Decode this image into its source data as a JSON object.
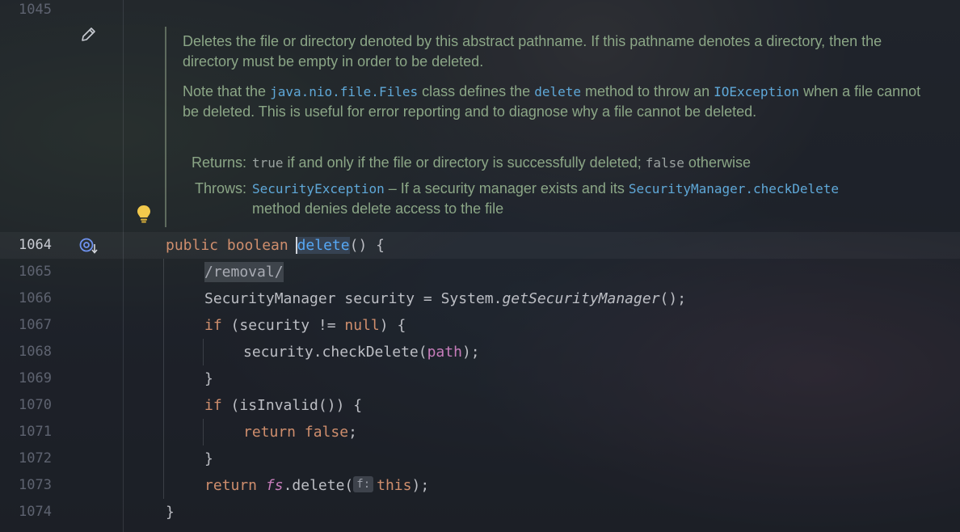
{
  "editor": {
    "language": "java",
    "doc": {
      "p1": "Deletes the file or directory denoted by this abstract pathname. If this pathname denotes a directory, then the directory must be empty in order to be deleted.",
      "p2_a": "Note that the ",
      "p2_code1": "java.nio.file.Files",
      "p2_b": " class defines the ",
      "p2_code2": "delete",
      "p2_c": " method to throw an ",
      "p2_code3": "IOException",
      "p2_d": " when a file cannot be deleted. This is useful for error reporting and to diagnose why a file cannot be deleted.",
      "returns_label": "Returns:",
      "returns_code1": "true",
      "returns_text": " if and only if the file or directory is successfully deleted; ",
      "returns_code2": "false",
      "returns_text2": " otherwise",
      "throws_label": "Throws:",
      "throws_code1": "SecurityException",
      "throws_text": " – If a security manager exists and its ",
      "throws_code2": "SecurityManager.checkDelete",
      "throws_text2": "method denies delete access to the file"
    },
    "line_numbers": [
      "1045",
      "1064",
      "1065",
      "1066",
      "1067",
      "1068",
      "1069",
      "1070",
      "1071",
      "1072",
      "1073",
      "1074"
    ],
    "code": {
      "l1064_public": "public",
      "l1064_boolean": "boolean",
      "l1064_name": "delete",
      "l1064_rest": "() {",
      "l1065": "/removal/",
      "l1066_a": "SecurityManager security = System.",
      "l1066_b": "getSecurityManager",
      "l1066_c": "();",
      "l1067_if": "if",
      "l1067_a": " (security != ",
      "l1067_null": "null",
      "l1067_b": ") {",
      "l1068_a": "security.checkDelete(",
      "l1068_path": "path",
      "l1068_b": ");",
      "l1069": "}",
      "l1070_if": "if",
      "l1070_a": " (isInvalid()) {",
      "l1071_return": "return",
      "l1071_false": "false",
      "l1071_b": ";",
      "l1072": "}",
      "l1073_return": "return",
      "l1073_fs": "fs",
      "l1073_a": ".delete(",
      "l1073_hint": "f:",
      "l1073_this": "this",
      "l1073_b": ");",
      "l1074": "}"
    },
    "icons": [
      "edit-pencil-icon",
      "lightbulb-icon",
      "override-method-icon"
    ],
    "colors": {
      "keyword": "#cf8e6d",
      "method": "#56a8f5",
      "field": "#c77dbb",
      "doc_text": "#8ba686",
      "doc_link": "#5fa8d8"
    }
  }
}
